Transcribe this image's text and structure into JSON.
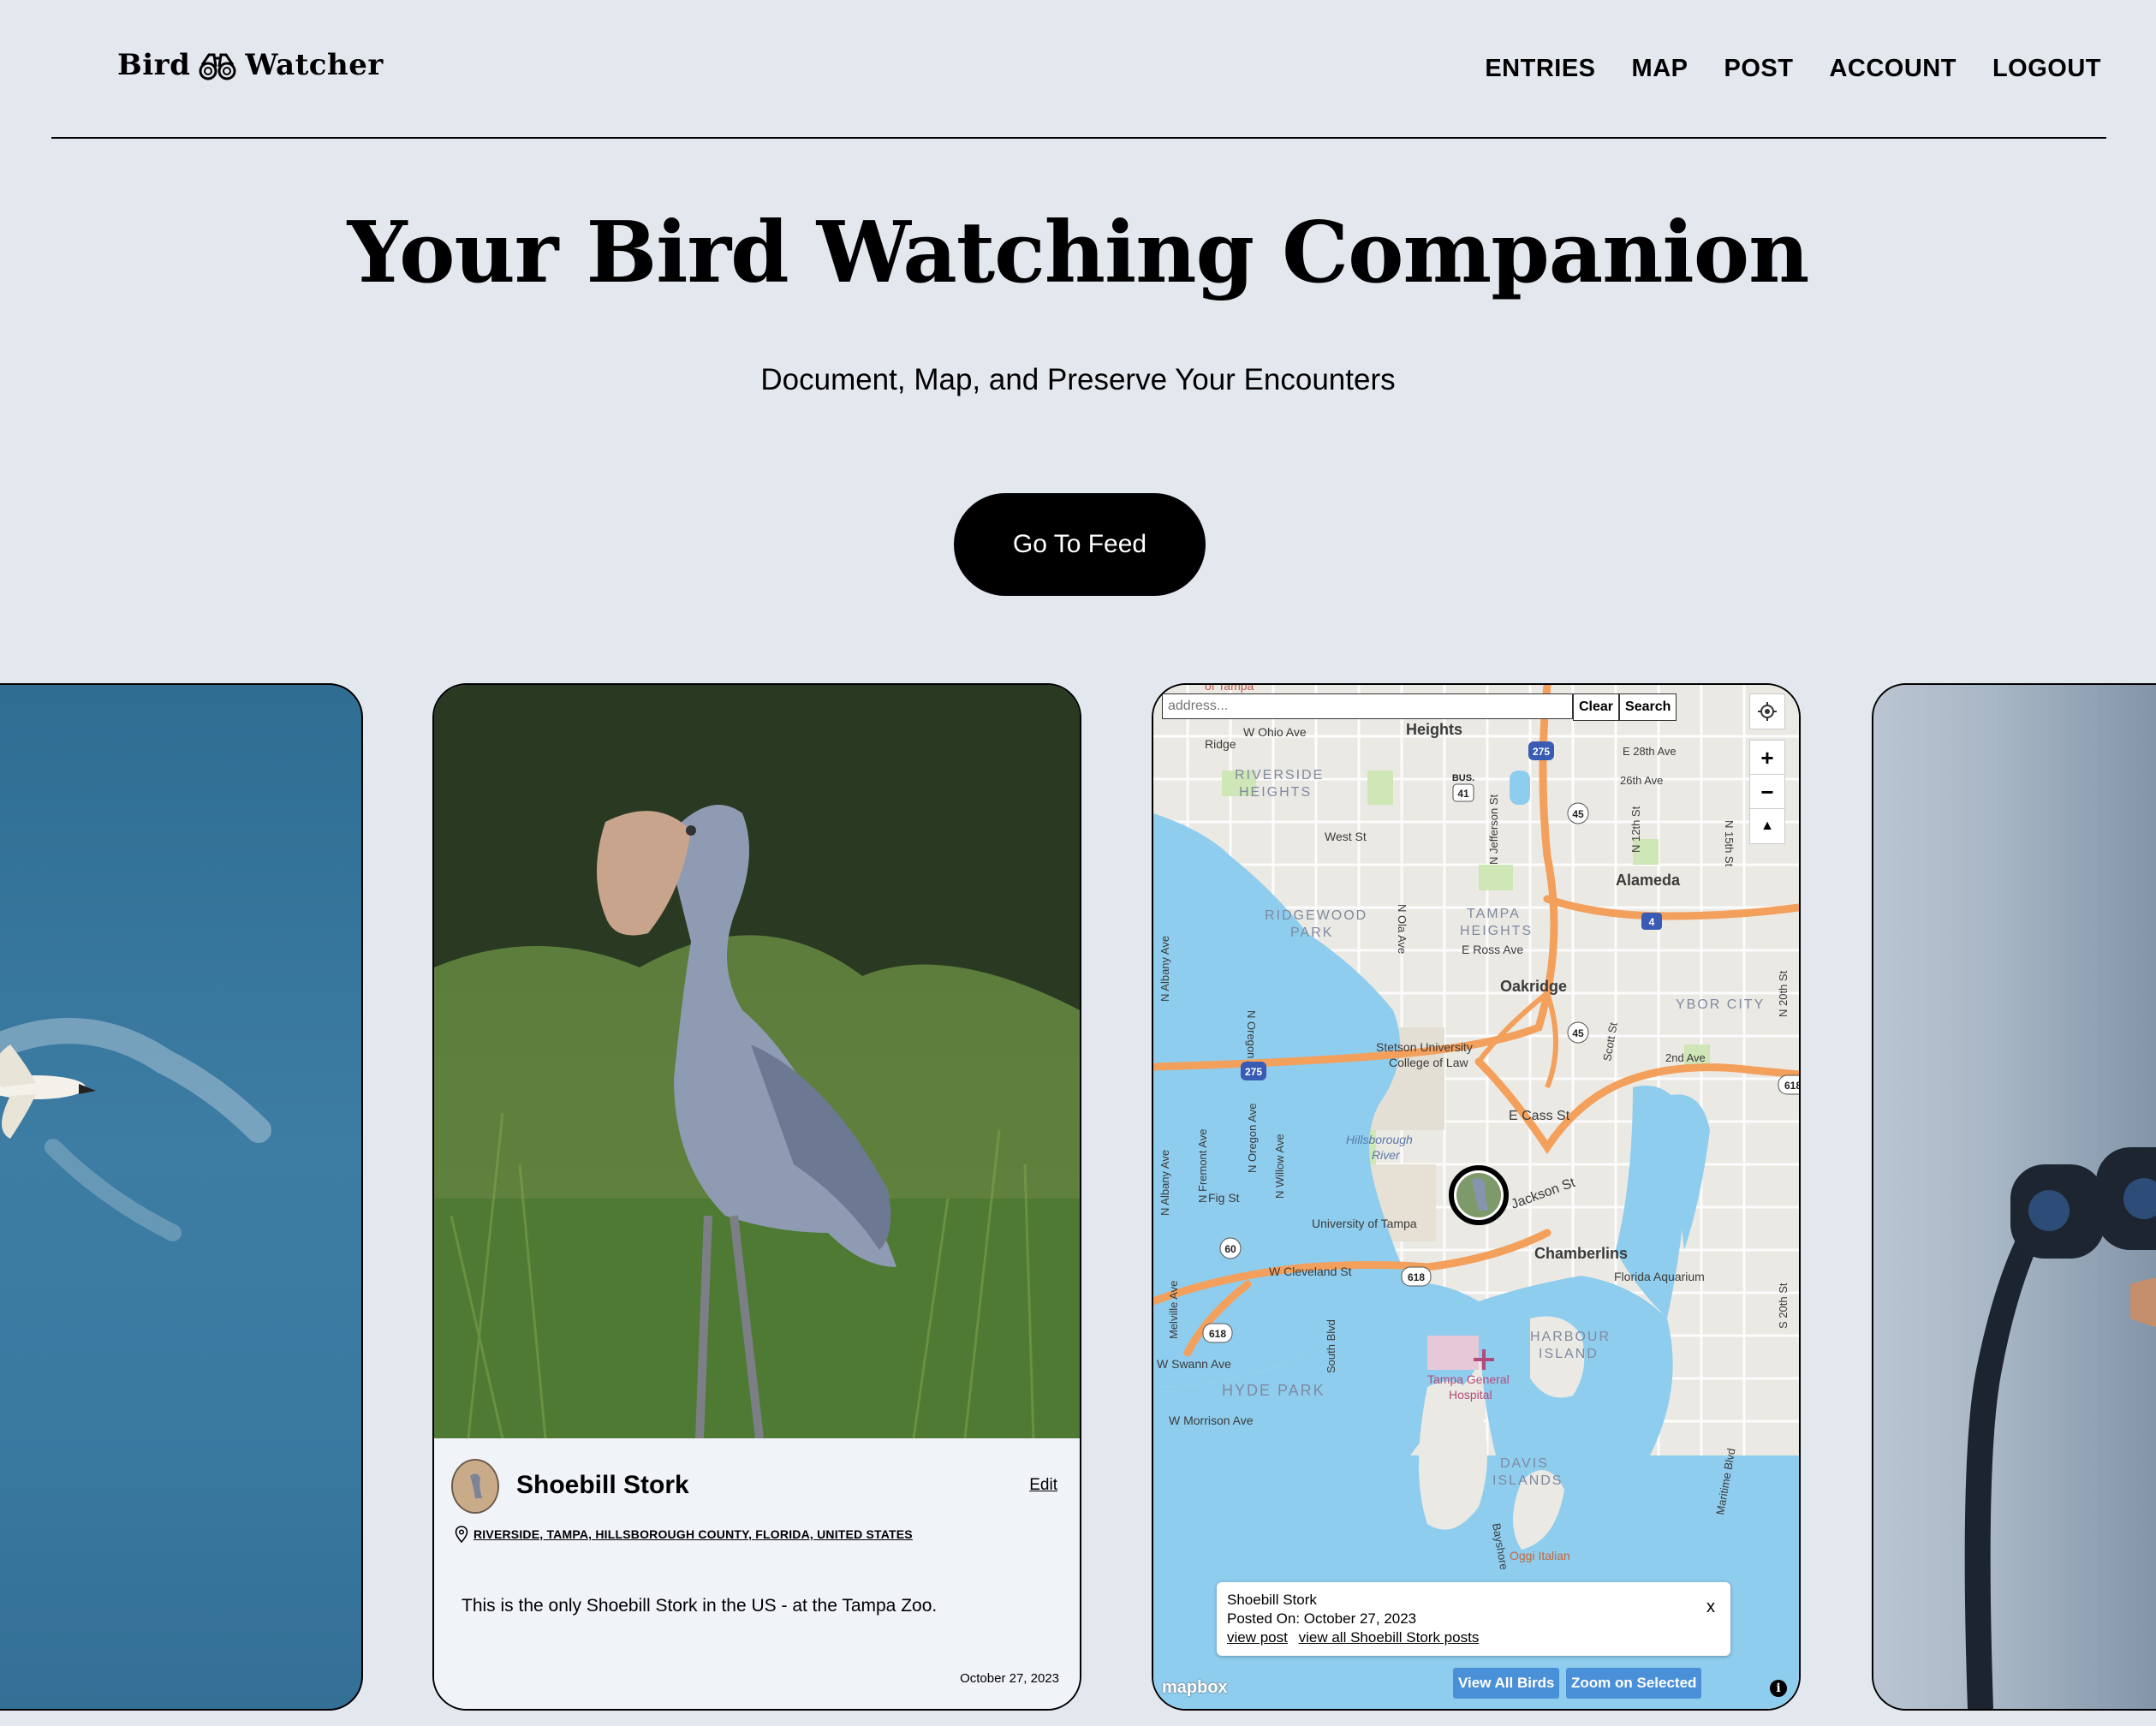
{
  "brand": {
    "name_left": "Bird",
    "name_right": "Watcher"
  },
  "nav": {
    "items": [
      "ENTRIES",
      "MAP",
      "POST",
      "ACCOUNT",
      "LOGOUT"
    ]
  },
  "hero": {
    "title": "Your Bird Watching Companion",
    "subtitle": "Document, Map, and Preserve Your Encounters",
    "cta_label": "Go To Feed"
  },
  "post": {
    "title": "Shoebill Stork",
    "edit_label": "Edit",
    "location": "RIVERSIDE, TAMPA, HILLSBOROUGH COUNTY, FLORIDA, UNITED STATES",
    "description": "This is the only Shoebill Stork in the US - at the Tampa Zoo.",
    "date": "October 27, 2023"
  },
  "map": {
    "search": {
      "placeholder": "address...",
      "clear_label": "Clear",
      "search_label": "Search"
    },
    "labels": {
      "top_cut": "of Tampa",
      "heights": "Heights",
      "w_ohio": "W Ohio Ave",
      "ridge": "Ridge",
      "riverside_heights": "RIVERSIDE",
      "riverside_heights2": "HEIGHTS",
      "west_st": "West St",
      "ridgewood": "RIDGEWOOD",
      "ridgewood2": "PARK",
      "tampa_heights": "TAMPA",
      "tampa_heights2": "HEIGHTS",
      "e_ross": "E Ross Ave",
      "alameda": "Alameda",
      "oakridge": "Oakridge",
      "ybor": "YBOR CITY",
      "e28": "E 28th Ave",
      "ave26": "26th Ave",
      "ave2": "2nd Ave",
      "stetson": "Stetson University",
      "stetson2": "College of Law",
      "hills_river": "Hillsborough",
      "hills_river2": "River",
      "e_cass": "E Cass St",
      "jackson": "Jackson St",
      "fig": "Fig St",
      "u_tampa": "University of Tampa",
      "cleveland": "W Cleveland St",
      "chamberlins": "Chamberlins",
      "aquarium": "Florida Aquarium",
      "harbour": "HARBOUR",
      "harbour2": "ISLAND",
      "swann": "W Swann Ave",
      "hyde": "HYDE PARK",
      "tgh": "Tampa General",
      "tgh2": "Hospital",
      "morrison": "W Morrison Ave",
      "davis": "DAVIS",
      "davis2": "ISLANDS",
      "oggi": "Oggi Italian",
      "n_albany": "N Albany Ave",
      "n_oregon": "N Oregon Ave",
      "n_willow": "N Willow Ave",
      "n_fremont": "N Fremont Ave",
      "melville": "Melville Ave",
      "south_blvd": "South Blvd",
      "n_jefferson": "N Jefferson St",
      "n_12th": "N 12th St",
      "n_15th": "N 15th St",
      "n_20th": "N 20th St",
      "s_20th": "S 20th St",
      "bayshore": "Bayshore",
      "maritime": "Maritime Blvd",
      "n_ola": "N Ola Ave",
      "scott": "Scott St",
      "r275": "275",
      "r45": "45",
      "r41": "41",
      "r618": "618",
      "r60": "60",
      "r4": "4",
      "bus": "BUS."
    },
    "popup": {
      "title": "Shoebill Stork",
      "posted": "Posted On: October 27, 2023",
      "view_post": "view post",
      "view_all": "view all Shoebill Stork posts",
      "close": "x"
    },
    "buttons": {
      "view_all": "View All Birds",
      "zoom_selected": "Zoom on Selected"
    },
    "attribution": "mapbox",
    "info": "i"
  },
  "colors": {
    "background": "#e3e7ee",
    "water": "#8fcdee",
    "highway": "#f3a05c",
    "map_button": "#4a90d9"
  }
}
